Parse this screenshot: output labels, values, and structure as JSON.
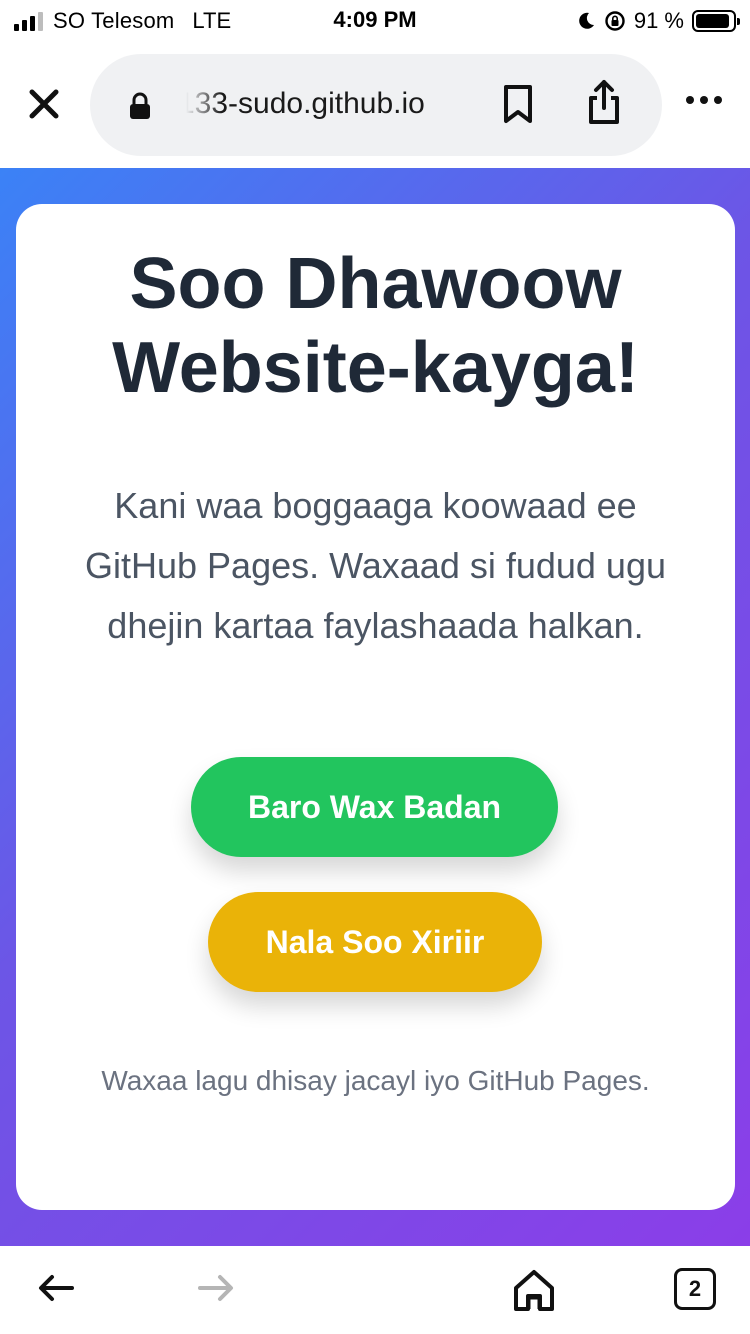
{
  "status_bar": {
    "carrier": "SO Telesom",
    "network": "LTE",
    "time": "4:09 PM",
    "battery_percent": "91 %",
    "battery_level": 0.91
  },
  "browser": {
    "url": "133-sudo.github.io",
    "icons": [
      "close-icon",
      "lock-icon",
      "bookmark-icon",
      "share-icon",
      "more-icon"
    ]
  },
  "page": {
    "title": "Soo Dhawoow Website-kayga!",
    "intro": "Kani waa boggaaga koowaad ee GitHub Pages. Waxaad si fudud ugu dhejin kartaa faylashaada halkan.",
    "primary_button": "Baro Wax Badan",
    "secondary_button": "Nala Soo Xiriir",
    "footer_note": "Waxaa lagu dhisay jacayl iyo GitHub Pages.",
    "colors": {
      "gradient_start": "#3b82f6",
      "gradient_end": "#8b3ee8",
      "primary_button": "#22c55e",
      "secondary_button": "#eab308",
      "title": "#1f2937"
    }
  },
  "bottom_bar": {
    "tab_count": "2",
    "icons": [
      "back-arrow-icon",
      "forward-arrow-icon",
      "home-icon",
      "tabs-icon"
    ]
  }
}
